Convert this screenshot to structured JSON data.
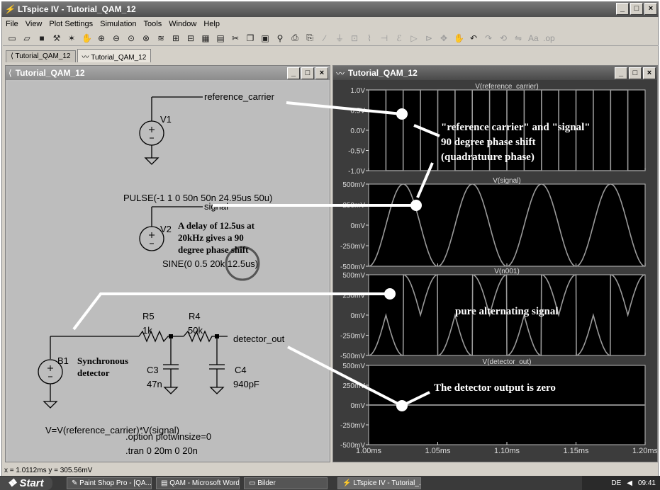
{
  "app": {
    "title": "LTspice IV - Tutorial_QAM_12"
  },
  "menu": [
    "File",
    "View",
    "Plot Settings",
    "Simulation",
    "Tools",
    "Window",
    "Help"
  ],
  "toolbar_icons": [
    "new-schematic-icon",
    "open-icon",
    "save-icon",
    "control-panel-icon",
    "run-icon",
    "halt-icon",
    "zoom-in-icon",
    "zoom-out-icon",
    "zoom-fit-icon",
    "zoom-cancel-icon",
    "autorange-icon",
    "grid-icon",
    "split-icon",
    "tile-icon",
    "cascade-icon",
    "cut-icon",
    "copy-icon",
    "paste-icon",
    "find-icon",
    "print-setup-icon",
    "print-icon",
    "wire-icon",
    "ground-icon",
    "label-icon",
    "resistor-icon",
    "capacitor-icon",
    "inductor-icon",
    "diode-icon",
    "component-icon",
    "move-icon",
    "drag-icon",
    "undo-icon",
    "redo-icon",
    "rotate-icon",
    "mirror-icon",
    "text-icon",
    "spice-directive-icon"
  ],
  "tabs": [
    "Tutorial_QAM_12",
    "Tutorial_QAM_12"
  ],
  "schematic": {
    "window_title": "Tutorial_QAM_12",
    "net_labels": [
      "reference_carrier",
      "signal",
      "detector_out"
    ],
    "v1": {
      "name": "V1",
      "value": "PULSE(-1 1 0 50n 50n 24.95us 50u)"
    },
    "v2": {
      "name": "V2",
      "value": "SINE(0 0.5 20k 12.5us)"
    },
    "b1": {
      "name": "B1",
      "value": "V=V(reference_carrier)*V(signal)"
    },
    "r5": {
      "name": "R5",
      "value": "1k"
    },
    "r4": {
      "name": "R4",
      "value": "50k"
    },
    "c3": {
      "name": "C3",
      "value": "47n"
    },
    "c4": {
      "name": "C4",
      "value": "940pF"
    },
    "directives": [
      ".option plotwinsize=0",
      ".tran 0 20m 0 20n"
    ],
    "notes": {
      "delay": [
        "A delay of 12.5us at",
        "20kHz gives a 90",
        "degree phase shift"
      ],
      "detector": [
        "Synchronous",
        "detector"
      ]
    }
  },
  "plot": {
    "window_title": "Tutorial_QAM_12",
    "panes": [
      {
        "title": "V(reference_carrier)",
        "yticks": [
          "1.0V",
          "0.5V",
          "0.0V",
          "-0.5V",
          "-1.0V"
        ],
        "ylim": [
          -1,
          1
        ]
      },
      {
        "title": "V(signal)",
        "yticks": [
          "500mV",
          "250mV",
          "0mV",
          "-250mV",
          "-500mV"
        ],
        "ylim": [
          -500,
          500
        ]
      },
      {
        "title": "V(n001)",
        "yticks": [
          "500mV",
          "250mV",
          "0mV",
          "-250mV",
          "-500mV"
        ],
        "ylim": [
          -500,
          500
        ]
      },
      {
        "title": "V(detector_out)",
        "yticks": [
          "500mV",
          "250mV",
          "0mV",
          "-250mV",
          "-500mV"
        ],
        "ylim": [
          -500,
          500
        ]
      }
    ],
    "xticks": [
      "1.00ms",
      "1.05ms",
      "1.10ms",
      "1.15ms",
      "1.20ms"
    ],
    "xlim": [
      1.0,
      1.2
    ]
  },
  "chart_data": [
    {
      "type": "line",
      "title": "V(reference_carrier)",
      "series": [
        {
          "name": "V(reference_carrier)",
          "x": [
            1.0,
            1.0125,
            1.0125,
            1.025,
            1.025,
            1.0375,
            1.0375,
            1.05,
            1.05,
            1.0625,
            1.0625,
            1.075,
            1.075,
            1.0875,
            1.0875,
            1.1,
            1.1,
            1.1125,
            1.1125,
            1.125,
            1.125,
            1.1375,
            1.1375,
            1.15,
            1.15,
            1.1625,
            1.1625,
            1.175,
            1.175,
            1.1875,
            1.1875,
            1.2
          ],
          "values": [
            1,
            1,
            -1,
            -1,
            1,
            1,
            -1,
            -1,
            1,
            1,
            -1,
            -1,
            1,
            1,
            -1,
            -1,
            1,
            1,
            -1,
            -1,
            1,
            1,
            -1,
            -1,
            1,
            1,
            -1,
            -1,
            1,
            1,
            -1,
            -1
          ]
        }
      ],
      "ylim": [
        -1,
        1
      ]
    },
    {
      "type": "line",
      "title": "V(signal)",
      "series": [
        {
          "name": "V(signal)",
          "function": "sine",
          "amplitude_mV": 500,
          "frequency_kHz": 20,
          "peaks_ms": [
            1.025,
            1.075,
            1.125,
            1.175
          ]
        }
      ],
      "ylim": [
        -500,
        500
      ]
    },
    {
      "type": "line",
      "title": "V(n001)",
      "series": [
        {
          "name": "V(n001)",
          "function": "product",
          "peak_mV": 500
        }
      ],
      "ylim": [
        -500,
        500
      ]
    },
    {
      "type": "line",
      "title": "V(detector_out)",
      "series": [
        {
          "name": "V(detector_out)",
          "values_mV": [
            0,
            0
          ]
        }
      ],
      "ylim": [
        -500,
        500
      ]
    }
  ],
  "annotations": {
    "phase": [
      "\"reference carrier\" and \"signal\"",
      "90 degree phase shift",
      "(quadratuure phase)"
    ],
    "alternating": "pure alternating signal",
    "detector_zero": "The detector output is zero"
  },
  "status": {
    "coords": "x = 1.0112ms   y = 305.56mV"
  },
  "taskbar": {
    "start": "Start",
    "tasks": [
      "Paint Shop Pro - [QA...",
      "QAM - Microsoft Word",
      "Bilder",
      "LTspice IV - Tutorial_..."
    ],
    "lang": "DE",
    "clock": "09:41"
  }
}
